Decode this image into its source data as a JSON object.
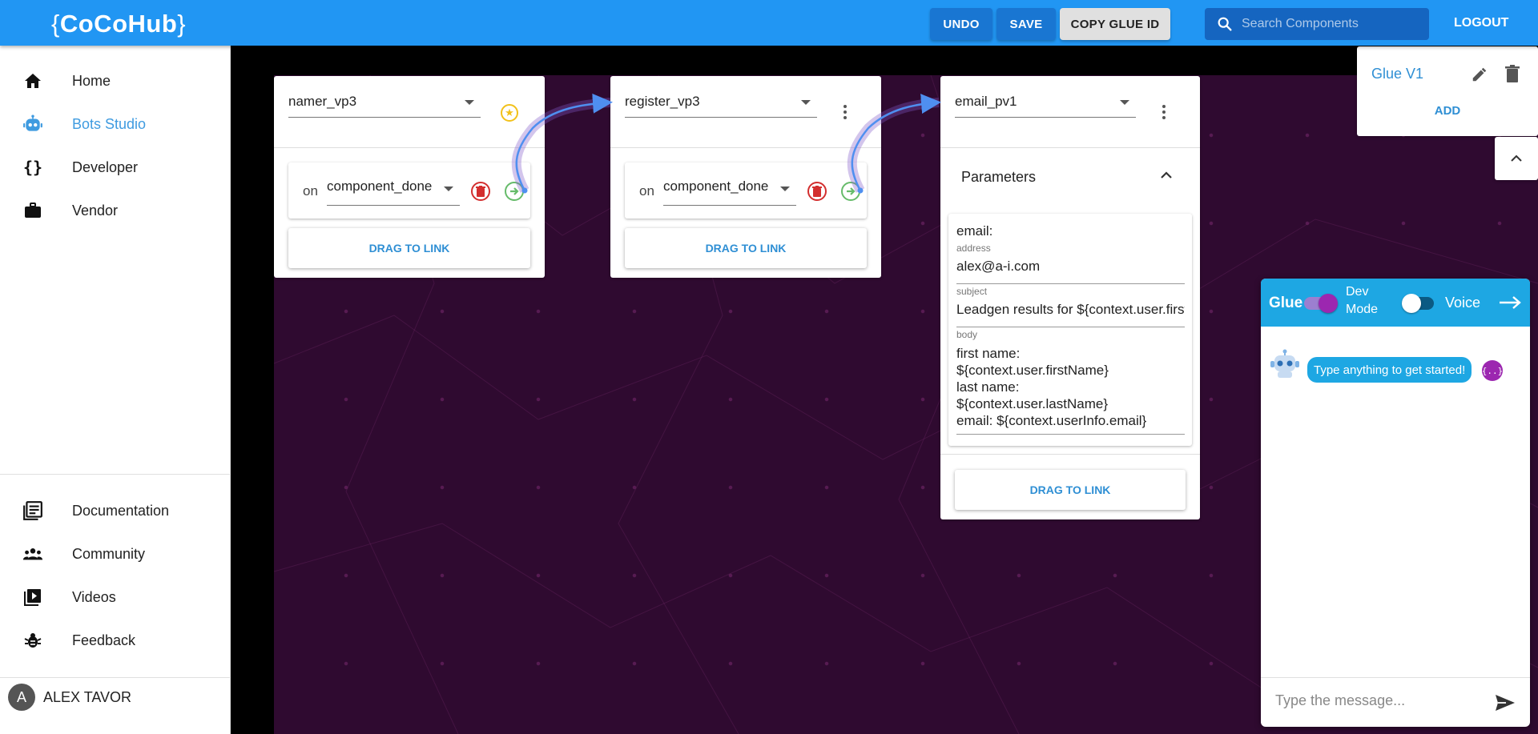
{
  "header": {
    "logo": "CoCoHub",
    "undo_label": "UNDO",
    "save_label": "SAVE",
    "copy_label": "COPY GLUE ID",
    "search_placeholder": "Search Components",
    "logout_label": "LOGOUT"
  },
  "sidebar": {
    "items": [
      {
        "label": "Home",
        "icon": "home-icon"
      },
      {
        "label": "Bots Studio",
        "icon": "robot-icon",
        "active": true
      },
      {
        "label": "Developer",
        "icon": "braces-icon"
      },
      {
        "label": "Vendor",
        "icon": "briefcase-icon"
      }
    ],
    "bottom_items": [
      {
        "label": "Documentation",
        "icon": "document-icon"
      },
      {
        "label": "Community",
        "icon": "people-icon"
      },
      {
        "label": "Videos",
        "icon": "video-library-icon"
      },
      {
        "label": "Feedback",
        "icon": "bug-icon"
      }
    ],
    "user": {
      "initial": "A",
      "name": "ALEX TAVOR"
    }
  },
  "canvas": {
    "components": [
      {
        "name": "namer_vp3",
        "event_on": "on",
        "event": "component_done",
        "drag_label": "DRAG TO LINK"
      },
      {
        "name": "register_vp3",
        "event_on": "on",
        "event": "component_done",
        "drag_label": "DRAG TO LINK"
      },
      {
        "name": "email_pv1",
        "parameters_title": "Parameters",
        "email_label": "email:",
        "fields": [
          {
            "label": "address",
            "value": "alex@a-i.com"
          },
          {
            "label": "subject",
            "value": "Leadgen results for ${context.user.firstName}"
          },
          {
            "label": "body",
            "value_lines": [
              "first name:",
              "${context.user.firstName}",
              "last name:",
              "${context.user.lastName}",
              "email: ${context.userInfo.email}"
            ]
          }
        ],
        "drag_label": "DRAG TO LINK"
      }
    ]
  },
  "glue_panel": {
    "name": "Glue V1",
    "add_label": "ADD"
  },
  "chat": {
    "glue_label": "Glue",
    "dev_mode_label_1": "Dev",
    "dev_mode_label_2": "Mode",
    "voice_label": "Voice",
    "message": "Type anything to get started!",
    "input_placeholder": "Type the message...",
    "colors": {
      "header": "#1ea7e3",
      "toggle_on": "#9c27b0"
    }
  },
  "colors": {
    "primary": "#2196f3",
    "canvas": "#2f0a30",
    "link": "#2f8fd4"
  }
}
